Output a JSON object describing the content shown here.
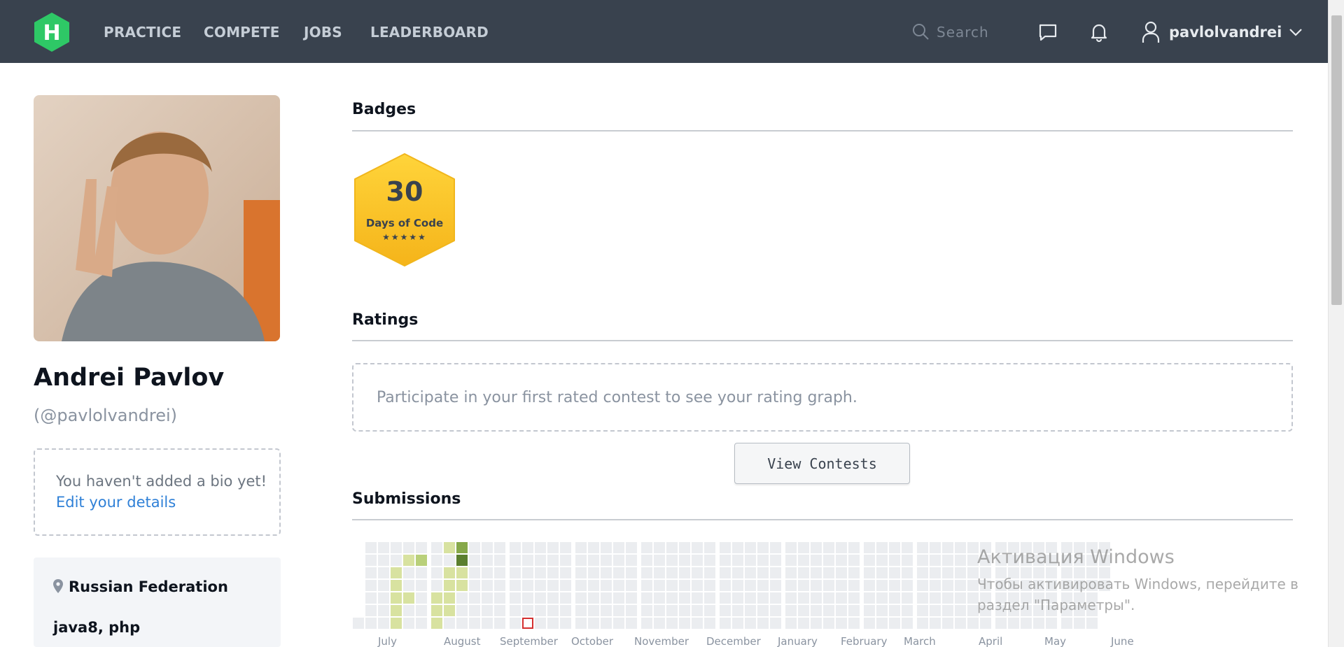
{
  "nav": {
    "logo_letter": "H",
    "items": [
      {
        "label": "PRACTICE"
      },
      {
        "label": "COMPETE"
      },
      {
        "label": "JOBS"
      },
      {
        "label": "LEADERBOARD"
      }
    ],
    "search_placeholder": "Search",
    "username": "pavlolvandrei",
    "icons": [
      "search-icon",
      "chat-icon",
      "bell-icon",
      "user-icon",
      "chevron-down-icon"
    ]
  },
  "profile": {
    "name": "Andrei Pavlov",
    "handle": "(@pavlolvandrei)",
    "bio_empty": "You haven't added a bio yet!",
    "bio_link": "Edit your details",
    "location": "Russian Federation",
    "languages": "java8, php"
  },
  "badges": {
    "title": "Badges",
    "items": [
      {
        "number": "30",
        "label": "Days of Code",
        "stars": 5,
        "stars_text": "★★★★★"
      }
    ]
  },
  "ratings": {
    "title": "Ratings",
    "empty_message": "Participate in your first rated contest to see your rating graph.",
    "button": "View Contests"
  },
  "submissions": {
    "title": "Submissions",
    "months": [
      "July",
      "August",
      "September",
      "October",
      "November",
      "December",
      "January",
      "February",
      "March",
      "April",
      "May",
      "June"
    ]
  },
  "watermark": {
    "title": "Активация Windows",
    "text": "Чтобы активировать Windows, перейдите в раздел \"Параметры\"."
  },
  "colors": {
    "topbar": "#39424e",
    "logo_green": "#2ec866",
    "badge_gold": "#ffc31c",
    "link_blue": "#2f80d7",
    "heat_empty": "#ebedf0",
    "heat_level1": "#d8e2a0",
    "heat_level2": "#b9d07a",
    "heat_level3": "#86a849",
    "heat_level4": "#5b7f2e"
  }
}
